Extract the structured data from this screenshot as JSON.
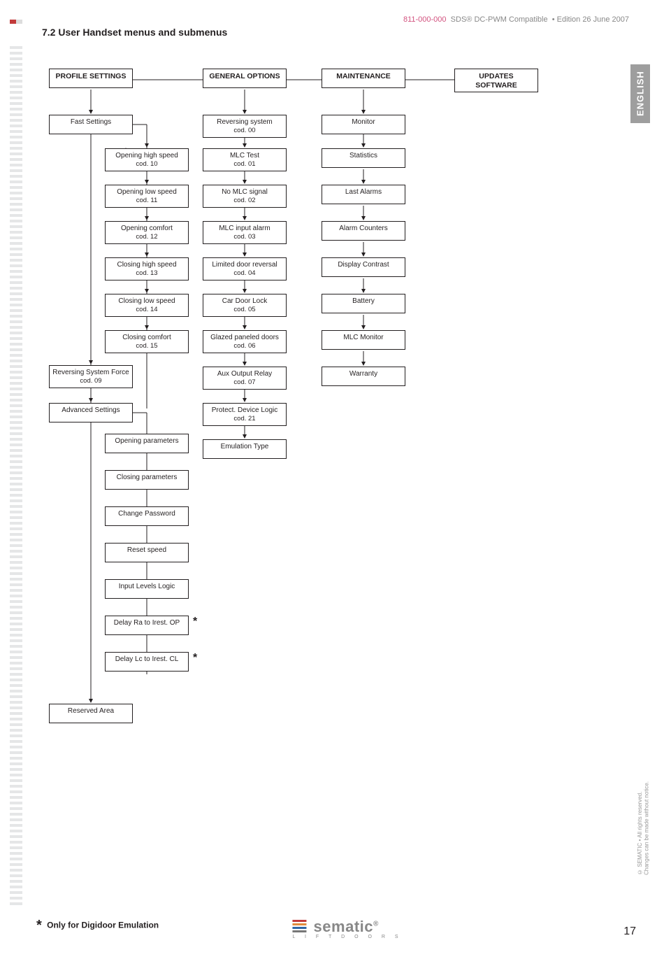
{
  "header": {
    "docnum": "811-000-000",
    "product": "SDS® DC-PWM Compatible",
    "edition": "Edition 26 June 2007"
  },
  "section_title": "7.2 User Handset menus and submenus",
  "lang_tab": "ENGLISH",
  "columns": {
    "profile": "PROFILE SETTINGS",
    "general": "GENERAL OPTIONS",
    "maintenance": "MAINTENANCE",
    "updates": "UPDATES SOFTWARE"
  },
  "profile": {
    "fast_settings": "Fast Settings",
    "items": [
      {
        "label": "Opening high speed",
        "sub": "cod. 10"
      },
      {
        "label": "Opening low speed",
        "sub": "cod. 11"
      },
      {
        "label": "Opening comfort",
        "sub": "cod. 12"
      },
      {
        "label": "Closing high speed",
        "sub": "cod. 13"
      },
      {
        "label": "Closing low speed",
        "sub": "cod. 14"
      },
      {
        "label": "Closing comfort",
        "sub": "cod. 15"
      }
    ],
    "rev_force": {
      "label": "Reversing System Force",
      "sub": "cod. 09"
    },
    "advanced": "Advanced Settings",
    "adv_items": [
      "Opening parameters",
      "Closing parameters",
      "Change Password",
      "Reset speed",
      "Input Levels Logic",
      "Delay Ra to Irest. OP",
      "Delay Lc to Irest. CL"
    ],
    "reserved": "Reserved Area"
  },
  "general": {
    "reversing": {
      "label": "Reversing system",
      "sub": "cod. 00"
    },
    "items": [
      {
        "label": "MLC Test",
        "sub": "cod. 01"
      },
      {
        "label": "No MLC signal",
        "sub": "cod. 02"
      },
      {
        "label": "MLC input alarm",
        "sub": "cod. 03"
      },
      {
        "label": "Limited door reversal",
        "sub": "cod. 04"
      },
      {
        "label": "Car Door Lock",
        "sub": "cod. 05"
      },
      {
        "label": "Glazed paneled doors",
        "sub": "cod. 06"
      },
      {
        "label": "Aux Output Relay",
        "sub": "cod. 07"
      },
      {
        "label": "Protect. Device Logic",
        "sub": "cod. 21"
      },
      {
        "label": "Emulation Type",
        "sub": ""
      }
    ]
  },
  "maintenance": {
    "monitor": "Monitor",
    "items": [
      "Statistics",
      "Last Alarms",
      "Alarm Counters",
      "Display Contrast",
      "Battery",
      "MLC Monitor",
      "Warranty"
    ]
  },
  "footnote": "Only for Digidoor Emulation",
  "page_number": "17",
  "copyright_lines": [
    "© SEMATIC • All rights reserved.",
    "Changes can be made without notice."
  ],
  "logo": {
    "name": "sematic",
    "tag": "L I F T   D O O R S"
  },
  "chart_data": {
    "type": "tree",
    "title": "User Handset menus and submenus",
    "roots": [
      {
        "name": "PROFILE SETTINGS",
        "children": [
          {
            "name": "Fast Settings",
            "children": [
              {
                "name": "Opening high speed",
                "code": "cod. 10"
              },
              {
                "name": "Opening low speed",
                "code": "cod. 11"
              },
              {
                "name": "Opening comfort",
                "code": "cod. 12"
              },
              {
                "name": "Closing high speed",
                "code": "cod. 13"
              },
              {
                "name": "Closing low speed",
                "code": "cod. 14"
              },
              {
                "name": "Closing comfort",
                "code": "cod. 15"
              }
            ]
          },
          {
            "name": "Reversing System Force",
            "code": "cod. 09"
          },
          {
            "name": "Advanced Settings",
            "children": [
              {
                "name": "Opening parameters"
              },
              {
                "name": "Closing parameters"
              },
              {
                "name": "Change Password"
              },
              {
                "name": "Reset speed"
              },
              {
                "name": "Input Levels Logic"
              },
              {
                "name": "Delay Ra to Irest. OP",
                "note": "*"
              },
              {
                "name": "Delay Lc to Irest. CL",
                "note": "*"
              }
            ]
          },
          {
            "name": "Reserved Area"
          }
        ]
      },
      {
        "name": "GENERAL OPTIONS",
        "children": [
          {
            "name": "Reversing system",
            "code": "cod. 00",
            "children": [
              {
                "name": "MLC Test",
                "code": "cod. 01"
              },
              {
                "name": "No MLC signal",
                "code": "cod. 02"
              },
              {
                "name": "MLC input alarm",
                "code": "cod. 03"
              },
              {
                "name": "Limited door reversal",
                "code": "cod. 04"
              },
              {
                "name": "Car Door Lock",
                "code": "cod. 05"
              },
              {
                "name": "Glazed paneled doors",
                "code": "cod. 06"
              },
              {
                "name": "Aux Output Relay",
                "code": "cod. 07"
              },
              {
                "name": "Protect. Device Logic",
                "code": "cod. 21"
              },
              {
                "name": "Emulation Type"
              }
            ]
          }
        ]
      },
      {
        "name": "MAINTENANCE",
        "children": [
          {
            "name": "Monitor",
            "children": [
              {
                "name": "Statistics"
              },
              {
                "name": "Last Alarms"
              },
              {
                "name": "Alarm Counters"
              },
              {
                "name": "Display Contrast"
              },
              {
                "name": "Battery"
              },
              {
                "name": "MLC Monitor"
              },
              {
                "name": "Warranty"
              }
            ]
          }
        ]
      },
      {
        "name": "UPDATES SOFTWARE",
        "children": []
      }
    ]
  }
}
